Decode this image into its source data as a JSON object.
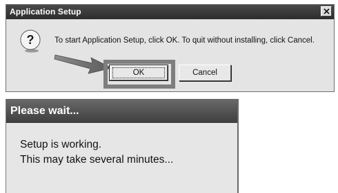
{
  "setup_dialog": {
    "title": "Application Setup",
    "message": "To start Application Setup, click OK. To quit without installing, click Cancel.",
    "ok_label": "OK",
    "cancel_label": "Cancel",
    "icon": "question-mark-icon",
    "close_icon": "close-icon"
  },
  "wait_dialog": {
    "title": "Please wait...",
    "line1": "Setup is working.",
    "line2": "This may take several minutes..."
  },
  "colors": {
    "titlebar": "#3a3a3a",
    "dialog_bg": "#e4e4e4",
    "highlight": "#7e7e7e"
  }
}
